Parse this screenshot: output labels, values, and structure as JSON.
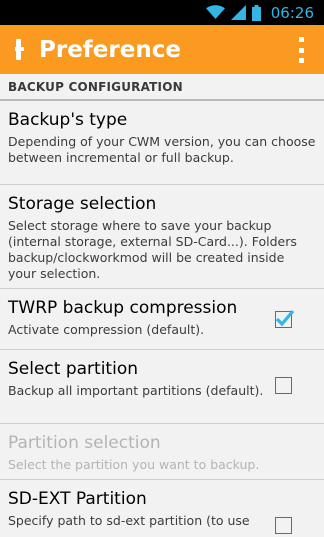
{
  "status_bar": {
    "time": "06:26"
  },
  "action_bar": {
    "title": "Preference"
  },
  "category": {
    "label": "BACKUP CONFIGURATION"
  },
  "preferences": [
    {
      "title": "Backup's type",
      "summary": "Depending of your CWM version, you can choose between incremental or full backup."
    },
    {
      "title": "Storage selection",
      "summary": "Select storage where to save your backup (internal storage, external SD-Card...). Folders backup/clockworkmod will be created inside your selection."
    },
    {
      "title": "TWRP backup compression",
      "summary": "Activate compression (default).",
      "checked": true
    },
    {
      "title": "Select partition",
      "summary": "Backup all important partitions (default).",
      "checked": false
    },
    {
      "title": "Partition selection",
      "summary": "Select the partition you want to backup.",
      "enabled": false
    },
    {
      "title": "SD-EXT Partition",
      "summary": "Specify path to sd-ext partition (to use",
      "checked": false
    }
  ],
  "colors": {
    "accent": "#fb9a21",
    "check": "#33b5e5",
    "status_icons": "#33b5e5"
  }
}
